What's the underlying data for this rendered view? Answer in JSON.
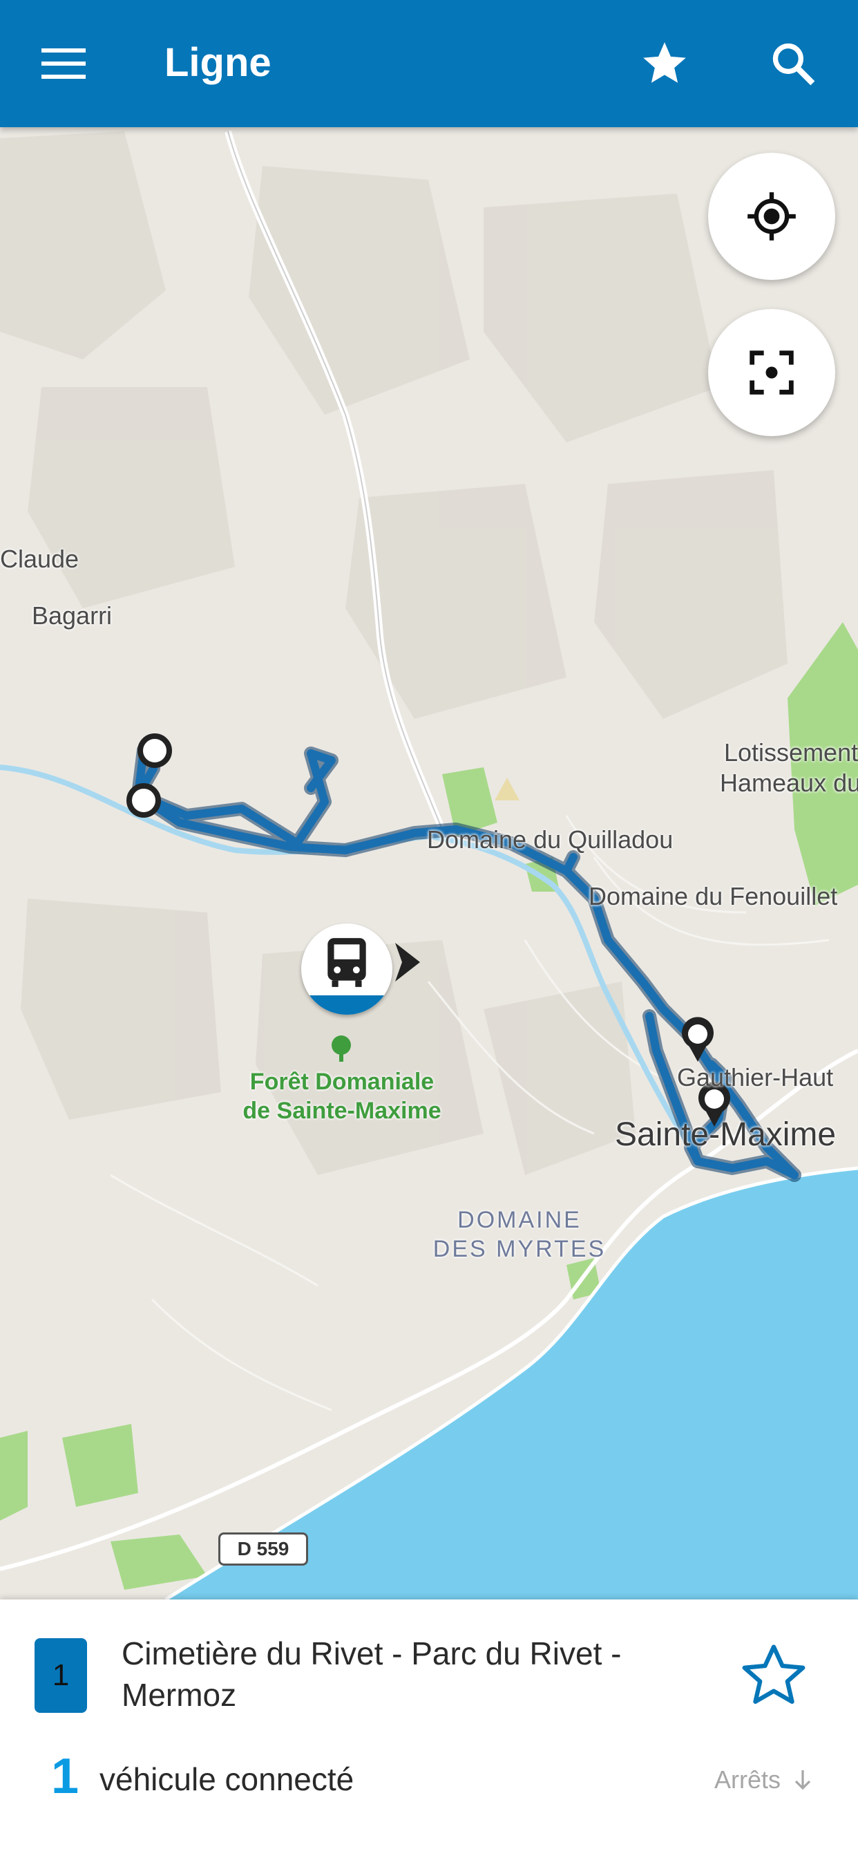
{
  "appbar": {
    "title": "Ligne",
    "icons": {
      "menu": "menu-icon",
      "favorite": "star-icon",
      "search": "search-icon"
    },
    "color": "#0576b8"
  },
  "map": {
    "labels": {
      "claude": "Claude",
      "bagarri": "Bagarri",
      "lotissement_1": "Lotissement",
      "lotissement_2": "Hameaux du",
      "quilladou": "Domaine du Quilladou",
      "fenouillet": "Domaine du Fenouillet",
      "gauthier": "Gauthier-Haut",
      "sainte_maxime": "Sainte-Maxime",
      "foret_1": "Forêt Domaniale",
      "foret_2": "de Sainte-Maxime",
      "myrtes_1": "DOMAINE",
      "myrtes_2": "DES MYRTES",
      "road_shield": "D 559"
    },
    "buttons": {
      "locate": "my-location-icon",
      "fit": "center-focus-icon"
    },
    "colors": {
      "route": "#1a6fb0",
      "sea": "#78cdee",
      "forest": "#a8d98a"
    }
  },
  "line": {
    "number": "1",
    "name": "Cimetière du Rivet - Parc du Rivet - Mermoz",
    "favorite_icon": "star-outline-icon"
  },
  "vehicles": {
    "count": "1",
    "label": "véhicule connecté"
  },
  "stops_link": {
    "label": "Arrêts",
    "icon": "arrow-down-icon"
  }
}
